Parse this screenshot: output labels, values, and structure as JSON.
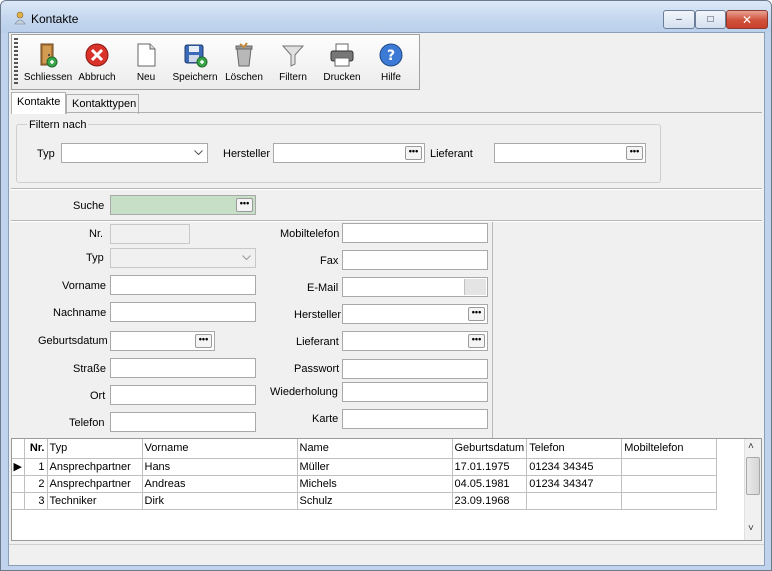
{
  "window": {
    "title": "Kontakte",
    "controls": {
      "minimize": "–",
      "maximize": "□",
      "close": "✕"
    }
  },
  "toolbar": {
    "items": [
      {
        "label": "Schliessen",
        "icon": "exit-door-icon"
      },
      {
        "label": "Abbruch",
        "icon": "cancel-icon"
      },
      {
        "label": "Neu",
        "icon": "new-document-icon"
      },
      {
        "label": "Speichern",
        "icon": "save-icon"
      },
      {
        "label": "Löschen",
        "icon": "delete-bin-icon"
      },
      {
        "label": "Filtern",
        "icon": "filter-funnel-icon"
      },
      {
        "label": "Drucken",
        "icon": "printer-icon"
      },
      {
        "label": "Hilfe",
        "icon": "help-icon"
      }
    ]
  },
  "tabs": [
    {
      "label": "Kontakte",
      "active": true
    },
    {
      "label": "Kontakttypen",
      "active": false
    }
  ],
  "filter": {
    "group_title": "Filtern nach",
    "typ_label": "Typ",
    "typ_value": "",
    "hersteller_label": "Hersteller",
    "hersteller_value": "",
    "lieferant_label": "Lieferant",
    "lieferant_value": ""
  },
  "search": {
    "label": "Suche",
    "value": ""
  },
  "ellipsis": "•••",
  "form": {
    "left": {
      "nr": "Nr.",
      "typ": "Typ",
      "vorname": "Vorname",
      "nachname": "Nachname",
      "geburtsdatum": "Geburtsdatum",
      "strasse": "Straße",
      "ort": "Ort",
      "telefon": "Telefon"
    },
    "right": {
      "mobiltelefon": "Mobiltelefon",
      "fax": "Fax",
      "email": "E-Mail",
      "hersteller": "Hersteller",
      "lieferant": "Lieferant",
      "passwort": "Passwort",
      "wiederholung": "Wiederholung",
      "karte": "Karte"
    }
  },
  "grid": {
    "columns": [
      "Nr.",
      "Typ",
      "Vorname",
      "Name",
      "Geburtsdatum",
      "Telefon",
      "Mobiltelefon"
    ],
    "rows": [
      [
        "1",
        "Ansprechpartner",
        "Hans",
        "Müller",
        "17.01.1975",
        "01234 34345",
        ""
      ],
      [
        "2",
        "Ansprechpartner",
        "Andreas",
        "Michels",
        "04.05.1981",
        "01234 34347",
        ""
      ],
      [
        "3",
        "Techniker",
        "Dirk",
        "Schulz",
        "23.09.1968",
        "",
        ""
      ]
    ],
    "current_row_marker": "▶"
  }
}
